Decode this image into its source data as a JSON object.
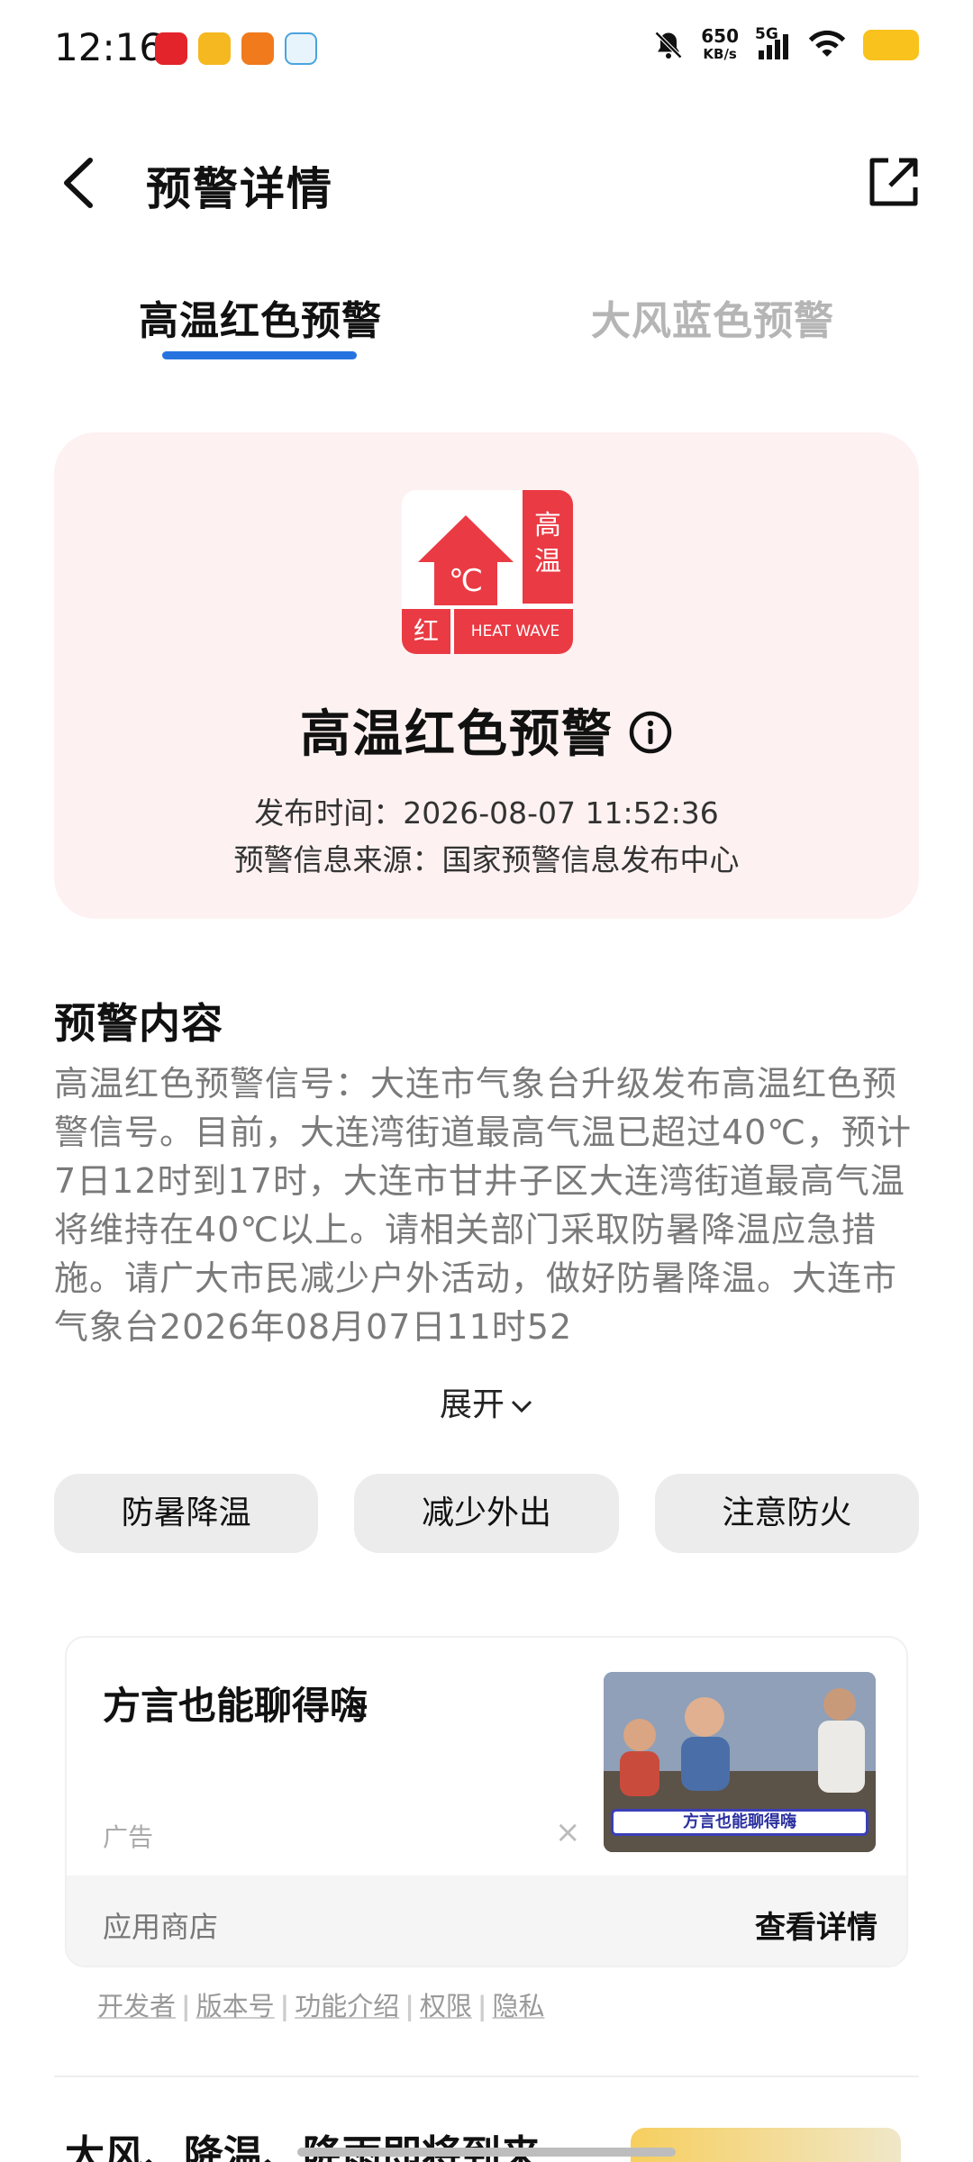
{
  "status_bar": {
    "time": "12:16",
    "net_speed": "650",
    "net_unit": "KB/s",
    "signal": "5G",
    "icons": [
      "huawei-health-icon",
      "sunny-app-icon",
      "sports-app-icon",
      "telegram-icon",
      "mute-bell-icon",
      "wifi-icon",
      "battery-icon"
    ],
    "battery_color": "#f9c21c"
  },
  "header": {
    "title": "预警详情"
  },
  "tabs": [
    {
      "label": "高温红色预警",
      "active": true
    },
    {
      "label": "大风蓝色预警",
      "active": false
    }
  ],
  "accent_color": "#2673e0",
  "warning": {
    "badge_side": "高温",
    "badge_color_word": "红",
    "badge_en": "HEAT WAVE",
    "badge_color": "#ea3a43",
    "title": "高温红色预警",
    "publish_time": "发布时间：2026-08-07 11:52:36",
    "source": "预警信息来源：国家预警信息发布中心"
  },
  "content": {
    "heading": "预警内容",
    "body": "高温红色预警信号：大连市气象台升级发布高温红色预警信号。目前，大连湾街道最高气温已超过40℃，预计7日12时到17时，大连市甘井子区大连湾街道最高气温将维持在40℃以上。请相关部门采取防暑降温应急措施。请广大市民减少户外活动，做好防暑降温。大连市气象台2026年08月07日11时52",
    "expand_label": "展开"
  },
  "chips": [
    "防暑降温",
    "减少外出",
    "注意防火"
  ],
  "ad": {
    "title": "方言也能聊得嗨",
    "tag": "广告",
    "close": "×",
    "thumb_caption": "方言也能聊得嗨",
    "store": "应用商店",
    "detail": "查看详情"
  },
  "links": [
    "开发者",
    "版本号",
    "功能介绍",
    "权限",
    "隐私"
  ],
  "next_item": {
    "title": "大风、降温、降雨即将到来"
  }
}
